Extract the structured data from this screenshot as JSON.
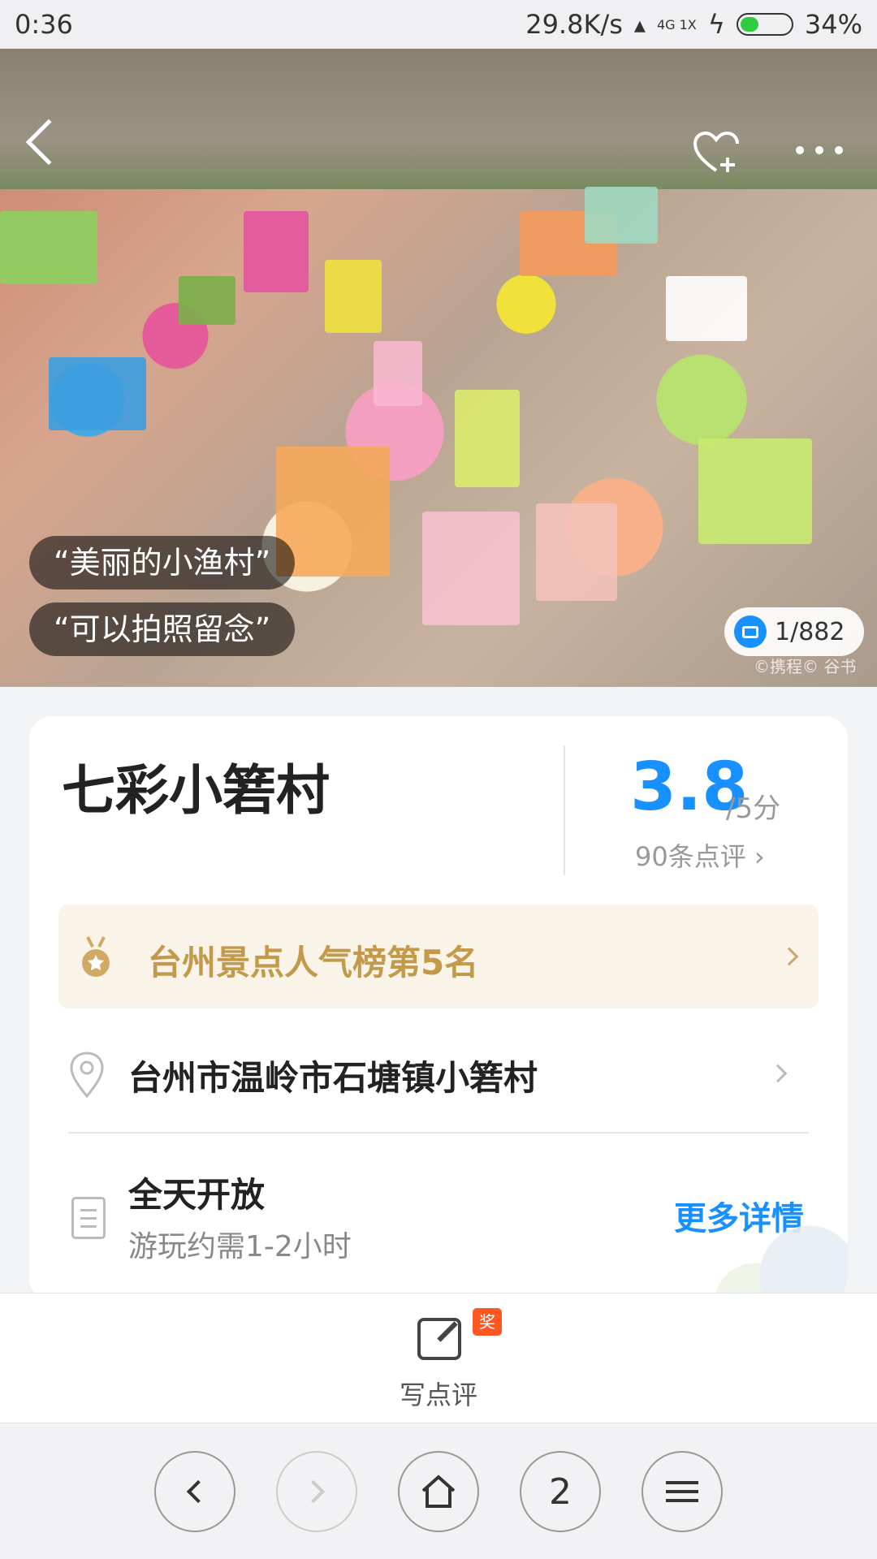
{
  "status_bar": {
    "time": "0:36",
    "speed": "29.8K/s",
    "signal_text": "4G 1X",
    "battery": "34%"
  },
  "hero": {
    "quotes": [
      "“美丽的小渔村”",
      "“可以拍照留念”"
    ],
    "photo_counter": "1/882",
    "credit": "©携程© 谷书"
  },
  "attraction": {
    "name": "七彩小箬村",
    "rating": "3.8",
    "rating_max": "/5分",
    "review_count": "90条点评",
    "ranking": "台州景点人气榜第5名",
    "address": "台州市温岭市石塘镇小箬村",
    "hours": "全天开放",
    "duration": "游玩约需1-2小时",
    "more_details": "更多详情"
  },
  "review_bar": {
    "badge": "奖",
    "label": "写点评"
  },
  "browser_nav": {
    "tab_count": "2"
  },
  "colors": {
    "accent": "#1890ff",
    "rank_bg": "#faf3e8",
    "rank_text": "#c29a4a",
    "badge": "#ff5722"
  },
  "icons": [
    "back-icon",
    "heart-plus-icon",
    "more-icon",
    "camera-icon",
    "medal-icon",
    "location-pin-icon",
    "document-icon",
    "chevron-right-icon",
    "edit-icon",
    "home-icon",
    "menu-icon"
  ]
}
